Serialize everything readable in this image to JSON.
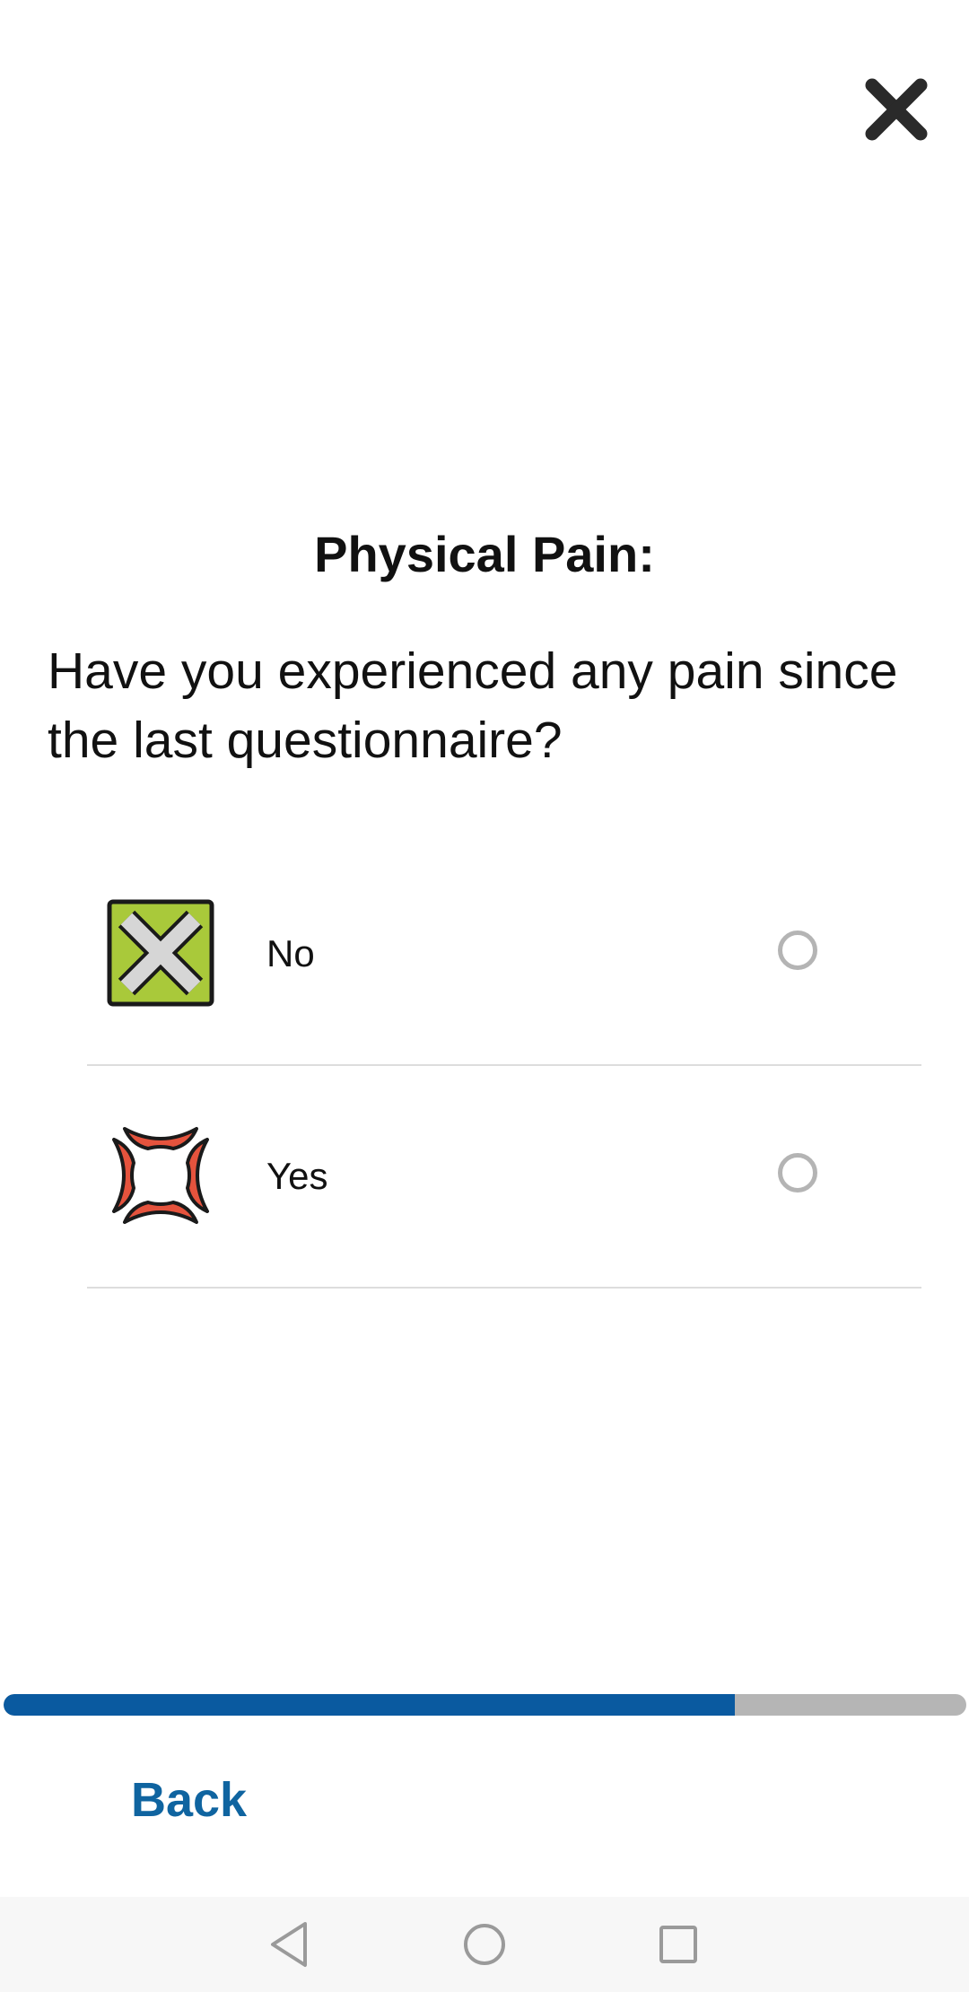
{
  "header": {
    "close_icon": "close-icon"
  },
  "question": {
    "section_title": "Physical Pain:",
    "text": "Have you experienced any pain since the last questionnaire?"
  },
  "options": [
    {
      "label": "No",
      "icon": "no-cross-icon",
      "selected": false
    },
    {
      "label": "Yes",
      "icon": "pain-anger-icon",
      "selected": false
    }
  ],
  "progress": {
    "fraction": 0.76
  },
  "footer": {
    "back_label": "Back"
  },
  "navbar": {
    "icons": [
      "back-triangle-icon",
      "home-circle-icon",
      "recents-square-icon"
    ]
  },
  "colors": {
    "accent": "#0a5aa0",
    "link": "#0f64a0",
    "progress_track": "#b5b5b5",
    "no_icon_bg": "#a9c93a",
    "yes_icon_red": "#e5533d"
  }
}
